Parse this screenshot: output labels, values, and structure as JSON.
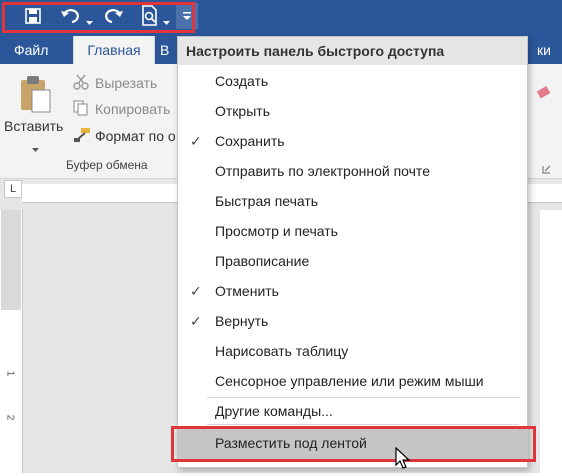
{
  "qat": {
    "icons": [
      "save-icon",
      "undo-icon",
      "dropdown-arrow-icon",
      "redo-icon",
      "print-preview-icon",
      "dropdown-arrow-icon",
      "customize-qat-icon"
    ]
  },
  "tabs": {
    "file": "Файл",
    "home": "Главная",
    "partial_left": "В",
    "partial_right": "ки"
  },
  "ribbon": {
    "paste": "Вставить",
    "cut": "Вырезать",
    "copy": "Копировать",
    "format_painter": "Формат по о",
    "clipboard_group": "Буфер обмена"
  },
  "ruler": {
    "corner": "L",
    "numbers": [
      "2",
      "1",
      "1",
      "2"
    ]
  },
  "menu": {
    "title": "Настроить панель быстрого доступа",
    "items": [
      {
        "label": "Создать",
        "checked": false
      },
      {
        "label": "Открыть",
        "checked": false
      },
      {
        "label": "Сохранить",
        "checked": true
      },
      {
        "label": "Отправить по электронной почте",
        "checked": false
      },
      {
        "label": "Быстрая печать",
        "checked": false
      },
      {
        "label": "Просмотр и печать",
        "checked": false
      },
      {
        "label": "Правописание",
        "checked": false
      },
      {
        "label": "Отменить",
        "checked": true
      },
      {
        "label": "Вернуть",
        "checked": true
      },
      {
        "label": "Нарисовать таблицу",
        "checked": false
      },
      {
        "label": "Сенсорное управление или режим мыши",
        "checked": false
      }
    ],
    "more_commands": "Другие команды...",
    "show_below": "Разместить под лентой",
    "check_glyph": "✓"
  },
  "colors": {
    "titlebar": "#2b579a",
    "highlight": "#e0353a",
    "ribbon": "#f3f3f3"
  }
}
